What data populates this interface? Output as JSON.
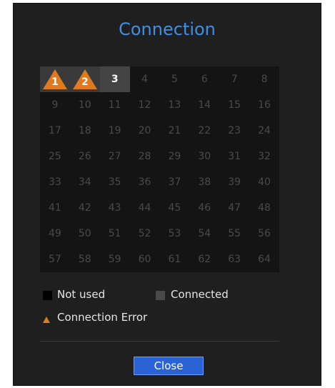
{
  "dialog": {
    "title": "Connection",
    "close_label": "Close"
  },
  "channels": [
    {
      "label": "1",
      "status": "error"
    },
    {
      "label": "2",
      "status": "error"
    },
    {
      "label": "3",
      "status": "connected"
    },
    {
      "label": "4",
      "status": "not_used"
    },
    {
      "label": "5",
      "status": "not_used"
    },
    {
      "label": "6",
      "status": "not_used"
    },
    {
      "label": "7",
      "status": "not_used"
    },
    {
      "label": "8",
      "status": "not_used"
    },
    {
      "label": "9",
      "status": "not_used"
    },
    {
      "label": "10",
      "status": "not_used"
    },
    {
      "label": "11",
      "status": "not_used"
    },
    {
      "label": "12",
      "status": "not_used"
    },
    {
      "label": "13",
      "status": "not_used"
    },
    {
      "label": "14",
      "status": "not_used"
    },
    {
      "label": "15",
      "status": "not_used"
    },
    {
      "label": "16",
      "status": "not_used"
    },
    {
      "label": "17",
      "status": "not_used"
    },
    {
      "label": "18",
      "status": "not_used"
    },
    {
      "label": "19",
      "status": "not_used"
    },
    {
      "label": "20",
      "status": "not_used"
    },
    {
      "label": "21",
      "status": "not_used"
    },
    {
      "label": "22",
      "status": "not_used"
    },
    {
      "label": "23",
      "status": "not_used"
    },
    {
      "label": "24",
      "status": "not_used"
    },
    {
      "label": "25",
      "status": "not_used"
    },
    {
      "label": "26",
      "status": "not_used"
    },
    {
      "label": "27",
      "status": "not_used"
    },
    {
      "label": "28",
      "status": "not_used"
    },
    {
      "label": "29",
      "status": "not_used"
    },
    {
      "label": "30",
      "status": "not_used"
    },
    {
      "label": "31",
      "status": "not_used"
    },
    {
      "label": "32",
      "status": "not_used"
    },
    {
      "label": "33",
      "status": "not_used"
    },
    {
      "label": "34",
      "status": "not_used"
    },
    {
      "label": "35",
      "status": "not_used"
    },
    {
      "label": "36",
      "status": "not_used"
    },
    {
      "label": "37",
      "status": "not_used"
    },
    {
      "label": "38",
      "status": "not_used"
    },
    {
      "label": "39",
      "status": "not_used"
    },
    {
      "label": "40",
      "status": "not_used"
    },
    {
      "label": "41",
      "status": "not_used"
    },
    {
      "label": "42",
      "status": "not_used"
    },
    {
      "label": "43",
      "status": "not_used"
    },
    {
      "label": "44",
      "status": "not_used"
    },
    {
      "label": "45",
      "status": "not_used"
    },
    {
      "label": "46",
      "status": "not_used"
    },
    {
      "label": "47",
      "status": "not_used"
    },
    {
      "label": "48",
      "status": "not_used"
    },
    {
      "label": "49",
      "status": "not_used"
    },
    {
      "label": "50",
      "status": "not_used"
    },
    {
      "label": "51",
      "status": "not_used"
    },
    {
      "label": "52",
      "status": "not_used"
    },
    {
      "label": "53",
      "status": "not_used"
    },
    {
      "label": "54",
      "status": "not_used"
    },
    {
      "label": "55",
      "status": "not_used"
    },
    {
      "label": "56",
      "status": "not_used"
    },
    {
      "label": "57",
      "status": "not_used"
    },
    {
      "label": "58",
      "status": "not_used"
    },
    {
      "label": "59",
      "status": "not_used"
    },
    {
      "label": "60",
      "status": "not_used"
    },
    {
      "label": "61",
      "status": "not_used"
    },
    {
      "label": "62",
      "status": "not_used"
    },
    {
      "label": "63",
      "status": "not_used"
    },
    {
      "label": "64",
      "status": "not_used"
    }
  ],
  "legend": {
    "not_used": "Not used",
    "connected": "Connected",
    "connection_error": "Connection Error"
  },
  "colors": {
    "title": "#3f8fe6",
    "error": "#e07a1f",
    "button": "#2a63d6"
  },
  "icons": {
    "error": "warning-triangle-icon"
  }
}
